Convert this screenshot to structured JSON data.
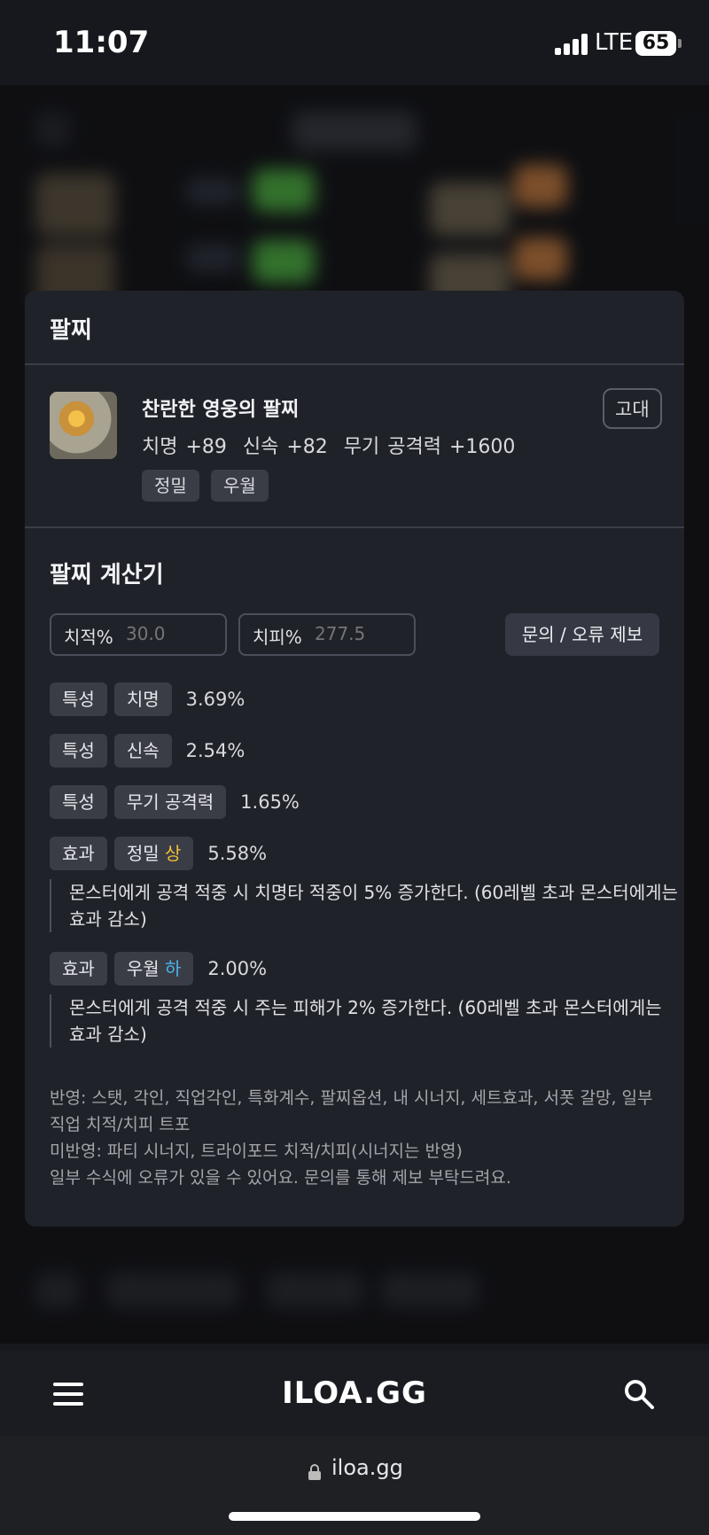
{
  "status_bar": {
    "time": "11:07",
    "network": "LTE",
    "battery": "65"
  },
  "modal": {
    "title": "팔찌",
    "item": {
      "name": "찬란한 영웅의 팔찌",
      "grade": "고대",
      "stats": "치명 +89  신속 +82  무기 공격력 +1600",
      "tags": [
        "정밀",
        "우월"
      ]
    },
    "calculator": {
      "title": "팔찌 계산기",
      "crit_rate": {
        "label": "치적%",
        "placeholder": "30.0"
      },
      "crit_damage": {
        "label": "치피%",
        "placeholder": "277.5"
      },
      "report_button": "문의 / 오류 제보",
      "rows": [
        {
          "type": "특성",
          "name": "치명",
          "value": "3.69%"
        },
        {
          "type": "특성",
          "name": "신속",
          "value": "2.54%"
        },
        {
          "type": "특성",
          "name": "무기 공격력",
          "value": "1.65%"
        },
        {
          "type": "효과",
          "name": "정밀",
          "grade": "상",
          "value": "5.58%",
          "description": "몬스터에게 공격 적중 시 치명타 적중이 5% 증가한다. (60레벨 초과 몬스터에게는 효과 감소)"
        },
        {
          "type": "효과",
          "name": "우월",
          "grade": "하",
          "value": "2.00%",
          "description": "몬스터에게 공격 적중 시 주는 피해가 2% 증가한다. (60레벨 초과 몬스터에게는 효과 감소)"
        }
      ],
      "notes": {
        "reflected": "반영: 스탯, 각인, 직업각인, 특화계수, 팔찌옵션, 내 시너지, 세트효과, 서폿 갈망, 일부 직업 치적/치피 트포",
        "not_reflected": "미반영: 파티 시너지, 트라이포드 치적/치피(시너지는 반영)",
        "disclaimer": "일부 수식에 오류가 있을 수 있어요. 문의를 통해 제보 부탁드려요."
      }
    }
  },
  "nav": {
    "logo": "ILOA.GG"
  },
  "browser": {
    "url": "iloa.gg"
  },
  "colors": {
    "grade_high": "#f2c234",
    "grade_low": "#4bb3ea",
    "card_bg": "#20222a"
  },
  "icons": [
    "menu-icon",
    "search-icon",
    "lock-icon",
    "signal-icon",
    "battery-icon"
  ]
}
